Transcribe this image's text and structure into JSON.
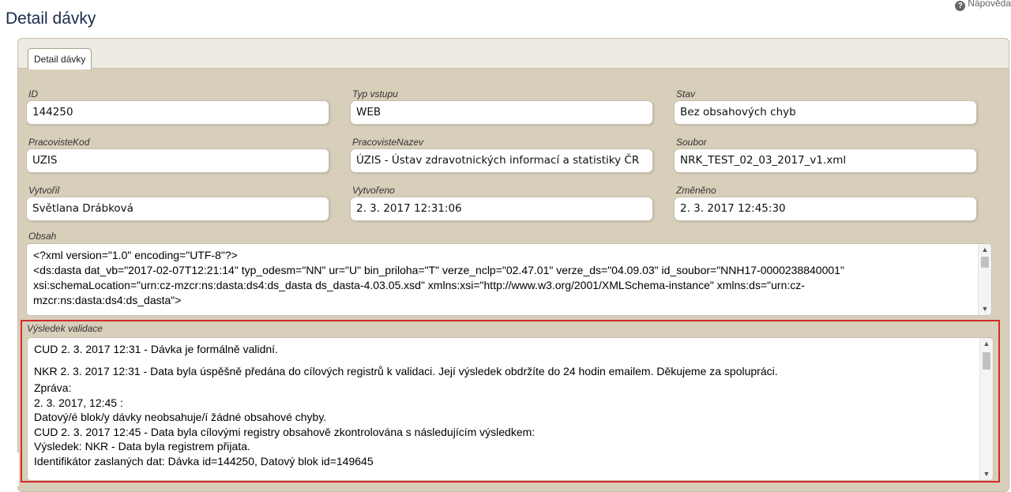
{
  "page": {
    "title": "Detail dávky",
    "help_label": "Nápověda"
  },
  "tab": {
    "label": "Detail dávky"
  },
  "fields": {
    "id": {
      "label": "ID",
      "value": "144250"
    },
    "typ_vstupu": {
      "label": "Typ vstupu",
      "value": "WEB"
    },
    "stav": {
      "label": "Stav",
      "value": "Bez obsahových chyb"
    },
    "pracoviste_kod": {
      "label": "PracovisteKod",
      "value": "UZIS"
    },
    "pracoviste_nazev": {
      "label": "PracovisteNazev",
      "value": "ÚZIS - Ústav zdravotnických informací a statistiky ČR"
    },
    "soubor": {
      "label": "Soubor",
      "value": "NRK_TEST_02_03_2017_v1.xml"
    },
    "vytvoril": {
      "label": "Vytvořil",
      "value": "Světlana Drábková"
    },
    "vytvoreno": {
      "label": "Vytvořeno",
      "value": "2. 3. 2017 12:31:06"
    },
    "zmeneno": {
      "label": "Změněno",
      "value": "2. 3. 2017 12:45:30"
    }
  },
  "obsah": {
    "label": "Obsah",
    "lines": [
      "<?xml version=\"1.0\" encoding=\"UTF-8\"?>",
      "<ds:dasta dat_vb=\"2017-02-07T12:21:14\" typ_odesm=\"NN\" ur=\"U\" bin_priloha=\"T\" verze_nclp=\"02.47.01\" verze_ds=\"04.09.03\" id_soubor=\"NNH17-0000238840001\"",
      "xsi:schemaLocation=\"urn:cz-mzcr:ns:dasta:ds4:ds_dasta ds_dasta-4.03.05.xsd\" xmlns:xsi=\"http://www.w3.org/2001/XMLSchema-instance\" xmlns:ds=\"urn:cz-",
      "mzcr:ns:dasta:ds4:ds_dasta\">"
    ]
  },
  "validation": {
    "label": "Výsledek validace",
    "lines": [
      "CUD 2. 3. 2017 12:31 - Dávka je formálně validní.",
      "NKR 2. 3. 2017 12:31 - Data byla úspěšně předána do cílových registrů k validaci. Její výsledek obdržíte do 24 hodin emailem. Děkujeme za spolupráci.",
      "Zpráva:",
      "2. 3. 2017, 12:45 :",
      "Datový/é blok/y dávky neobsahuje/í žádné obsahové chyby.",
      "CUD 2. 3. 2017 12:45 - Data byla cílovými registry obsahově zkontrolována s následujícím výsledkem:",
      "Výsledek: NKR - Data byla registrem přijata.",
      "Identifikátor zaslaných dat: Dávka id=144250, Datový blok id=149645"
    ]
  },
  "colors": {
    "panel_bg": "#d8cfba",
    "highlight_border": "#d42a2a",
    "title_text": "#1a2b4c"
  },
  "icons": {
    "help": "help-circle-icon",
    "scroll_up": "chevron-up-icon",
    "scroll_down": "chevron-down-icon"
  }
}
